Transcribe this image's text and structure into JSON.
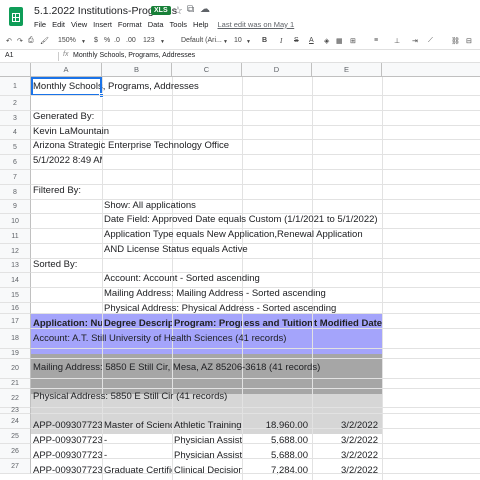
{
  "doc": {
    "title": "5.1.2022 Institutions-Programs",
    "badge": "XLS",
    "last_edit": "Last edit was on May 1"
  },
  "menu": [
    "File",
    "Edit",
    "View",
    "Insert",
    "Format",
    "Data",
    "Tools",
    "Help"
  ],
  "toolbar": {
    "zoom": "150%",
    "currency": "$",
    "percent": "%",
    "dec_dec": ".0",
    "dec_inc": ".00",
    "more_formats": "123",
    "font": "Default (Ari...",
    "font_size": "10",
    "bold": "B",
    "italic": "I",
    "strike": "S",
    "text_color": "A"
  },
  "formula_bar": {
    "cell_ref": "A1",
    "fx": "fx",
    "value": "Monthly Schools, Programs, Addresses"
  },
  "columns": [
    "A",
    "B",
    "C",
    "D",
    "E"
  ],
  "rows": {
    "r1": "Monthly Schools, Programs, Addresses",
    "r3": "Generated By:",
    "r4": "Kevin LaMountain",
    "r5": "Arizona Strategic Enterprise Technology Office",
    "r6": "5/1/2022 8:49 AM",
    "r8": "Filtered By:",
    "r9": "Show: All applications",
    "r10": "Date Field: Approved Date equals Custom (1/1/2021 to 5/1/2022)",
    "r11": "Application Type equals New Application,Renewal Application",
    "r12": "AND License Status equals Active",
    "r13": "Sorted By:",
    "r14": "Account: Account - Sorted ascending",
    "r15": "Mailing Address: Mailing Address - Sorted ascending",
    "r16": "Physical Address: Physical Address - Sorted ascending",
    "r17": [
      "Application: Nu",
      "Degree Descrip",
      "Program: Progre",
      "ess and Tuition:",
      "t Modified Date"
    ],
    "r18": "Account: A.T. Still University of Health Sciences (41 records)",
    "r20": "Mailing Address: 5850 E Still Cir, Mesa, AZ 85206-3618 (41 records)",
    "r22": "Physical Address: 5850 E Still Cir (41 records)",
    "data": [
      {
        "row": "24",
        "a": "APP-009307723",
        "b": "Master of Scienc",
        "c": "Athletic Training",
        "d": "18,960.00",
        "e": "3/2/2022"
      },
      {
        "row": "25",
        "a": "APP-009307723",
        "b": "-",
        "c": "Physician Assista",
        "d": "5,688.00",
        "e": "3/2/2022"
      },
      {
        "row": "26",
        "a": "APP-009307723",
        "b": "-",
        "c": "Physician Assista",
        "d": "5,688.00",
        "e": "3/2/2022"
      },
      {
        "row": "27",
        "a": "APP-009307723",
        "b": "Graduate Certific",
        "c": "Clinical Decision",
        "d": "7,284.00",
        "e": "3/2/2022"
      }
    ]
  },
  "colors": {
    "header_band": "#a4a4fb",
    "account_band": "#a4a4fb",
    "mailing_band": "#a6a6a6",
    "physical_band": "#d6d6d6",
    "selection": "#1a73e8"
  }
}
